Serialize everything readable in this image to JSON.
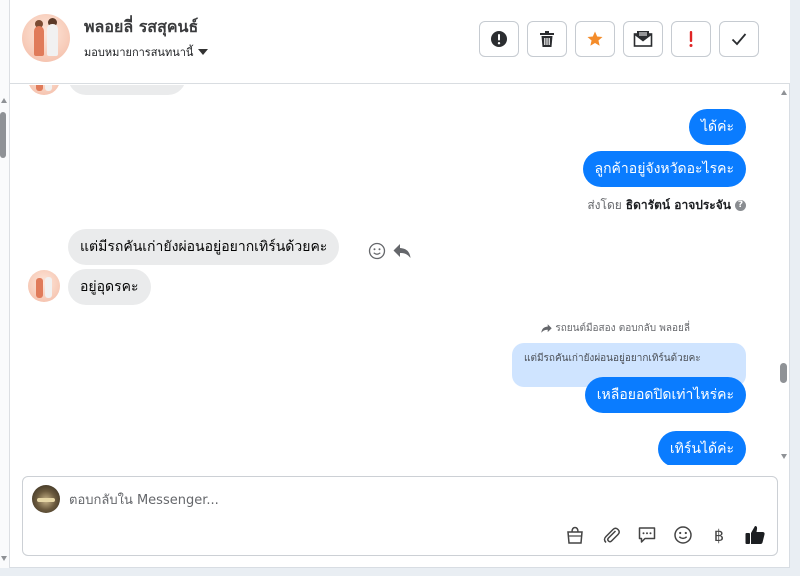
{
  "header": {
    "contact_name": "พลอยลี่ รสสุคนธ์",
    "assign_label": "มอบหมายการสนทนานี้"
  },
  "toolbar": {
    "buttons": [
      {
        "name": "spam-alert",
        "icon": "exclamation-circle-icon"
      },
      {
        "name": "delete",
        "icon": "trash-icon"
      },
      {
        "name": "star",
        "icon": "star-icon",
        "color": "#f48c2a"
      },
      {
        "name": "mark-unread",
        "icon": "envelope-icon"
      },
      {
        "name": "mark-important",
        "icon": "exclamation-icon",
        "color": "#e02424"
      },
      {
        "name": "mark-done",
        "icon": "check-icon"
      }
    ]
  },
  "messages": {
    "out_1": "ได้ค่ะ",
    "out_2": "ลูกค้าอยู่จังหวัดอะไรคะ",
    "sent_by_prefix": "ส่งโดย",
    "sent_by_name": "ธิดารัตน์ อาจประจัน",
    "in_1": "แต่มีรถคันเก่ายังผ่อนอยู่อยากเทิร์นด้วยคะ",
    "in_2": "อยู่อุดรคะ",
    "reply_header": "รถยนต์มือสอง ตอบกลับ พลอยลี่",
    "quoted_text": "แต่มีรถคันเก่ายังผ่อนอยู่อยากเทิร์นด้วยคะ",
    "out_3": "เหลือยอดปิดเท่าไหร่คะ",
    "out_4": "เทิร์นได้ค่ะ"
  },
  "composer": {
    "placeholder": "ตอบกลับใน Messenger..."
  },
  "composer_tools": [
    "shopping-bag-icon",
    "paperclip-icon",
    "speech-bubble-icon",
    "emoji-icon",
    "baht-icon",
    "thumbs-up-icon"
  ],
  "baht_symbol": "฿",
  "colors": {
    "accent": "#0a7cff",
    "incoming_bubble": "#eaebec",
    "quoted_bubble": "#cfe4ff"
  }
}
